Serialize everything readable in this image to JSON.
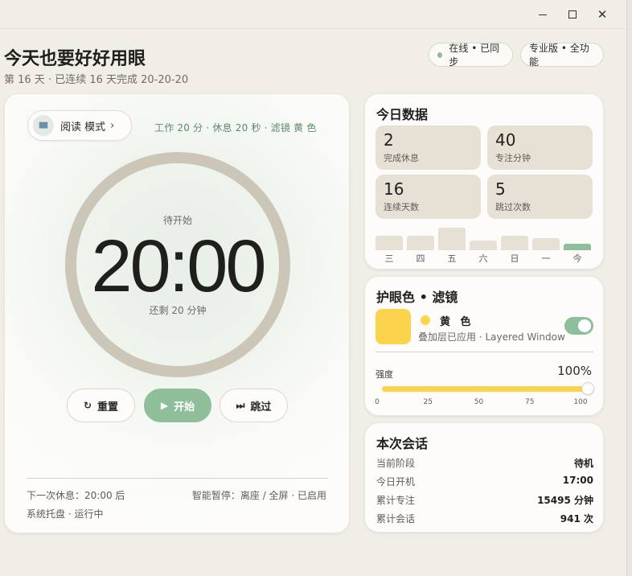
{
  "window": {
    "min_icon": "minimize-icon",
    "max_icon": "maximize-icon",
    "close_icon": "close-icon"
  },
  "header": {
    "title": "今天也要好好用眼",
    "subtitle": "第 16 天 · 已连续 16 天完成 20-20-20",
    "status_pill": "在线 • 已同步",
    "plan_pill": "专业版 • 全功能"
  },
  "timer_card": {
    "mode_label": "阅读 模式",
    "mode_info": "工作 20 分 · 休息 20 秒 · 滤镜 黄 色",
    "status": "待开始",
    "time": "20:00",
    "remaining": "还剩 20 分钟",
    "reset_label": "重置",
    "start_label": "开始",
    "skip_label": "跳过",
    "next_break": "下一次休息：20:00 后",
    "smart_pause": "智能暂停：离座 / 全屏 · 已启用",
    "tray": "系统托盘 · 运行中"
  },
  "today": {
    "title": "今日数据",
    "stats": [
      {
        "value": "2",
        "label": "完成休息"
      },
      {
        "value": "40",
        "label": "专注分钟"
      },
      {
        "value": "16",
        "label": "连续天数"
      },
      {
        "value": "5",
        "label": "跳过次数"
      }
    ],
    "chart_data": {
      "type": "bar",
      "categories": [
        "三",
        "四",
        "五",
        "六",
        "日",
        "一",
        "今"
      ],
      "values": [
        17,
        17,
        27,
        12,
        17,
        14,
        8
      ],
      "highlight": "今",
      "colors": {
        "default": "#e7e1d5",
        "today": "#8ebf9a"
      }
    }
  },
  "filter": {
    "title": "护眼色 • 滤镜",
    "color_name": "黄 色",
    "color_hex": "#fcd34d",
    "description": "叠加层已应用 · Layered Window",
    "enabled": true,
    "intensity_label": "强度",
    "intensity_value": "100%",
    "intensity": 1.0,
    "ticks": [
      "0",
      "25",
      "50",
      "75",
      "100"
    ]
  },
  "session": {
    "title": "本次会话",
    "rows": [
      {
        "label": "当前阶段",
        "value": "待机"
      },
      {
        "label": "今日开机",
        "value": "17:00"
      },
      {
        "label": "累计专注",
        "value": "15495 分钟"
      },
      {
        "label": "累计会话",
        "value": "941 次"
      }
    ]
  },
  "colors": {
    "accent": "#8ebf9a",
    "ring": "#ccc6b9",
    "background": "#f1eee8"
  }
}
